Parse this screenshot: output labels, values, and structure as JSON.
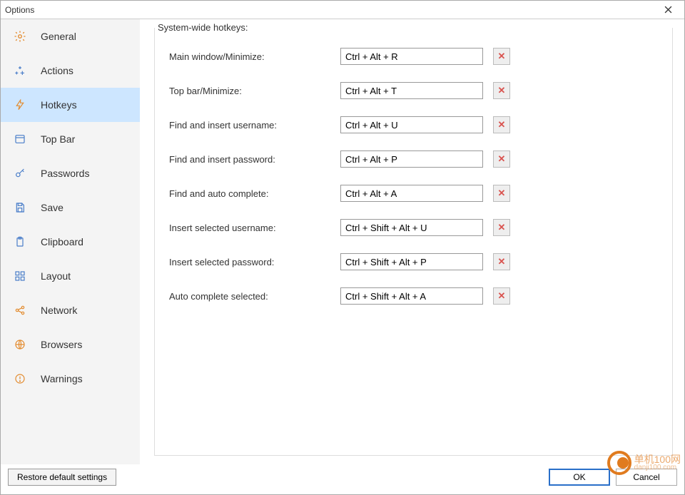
{
  "window": {
    "title": "Options"
  },
  "sidebar": {
    "items": [
      {
        "label": "General"
      },
      {
        "label": "Actions"
      },
      {
        "label": "Hotkeys"
      },
      {
        "label": "Top Bar"
      },
      {
        "label": "Passwords"
      },
      {
        "label": "Save"
      },
      {
        "label": "Clipboard"
      },
      {
        "label": "Layout"
      },
      {
        "label": "Network"
      },
      {
        "label": "Browsers"
      },
      {
        "label": "Warnings"
      }
    ]
  },
  "section_title": "System-wide hotkeys:",
  "hotkeys": [
    {
      "label": "Main window/Minimize:",
      "value": "Ctrl + Alt + R"
    },
    {
      "label": "Top bar/Minimize:",
      "value": "Ctrl + Alt + T"
    },
    {
      "label": "Find and insert username:",
      "value": "Ctrl + Alt + U"
    },
    {
      "label": "Find and insert password:",
      "value": "Ctrl + Alt + P"
    },
    {
      "label": "Find and auto complete:",
      "value": "Ctrl + Alt + A"
    },
    {
      "label": "Insert selected username:",
      "value": "Ctrl + Shift + Alt + U"
    },
    {
      "label": "Insert selected password:",
      "value": "Ctrl + Shift + Alt + P"
    },
    {
      "label": "Auto complete selected:",
      "value": "Ctrl + Shift + Alt + A"
    }
  ],
  "footer": {
    "restore": "Restore default settings",
    "ok": "OK",
    "cancel": "Cancel"
  },
  "watermark": {
    "line1": "单机100网",
    "line2": "danji100.com"
  }
}
